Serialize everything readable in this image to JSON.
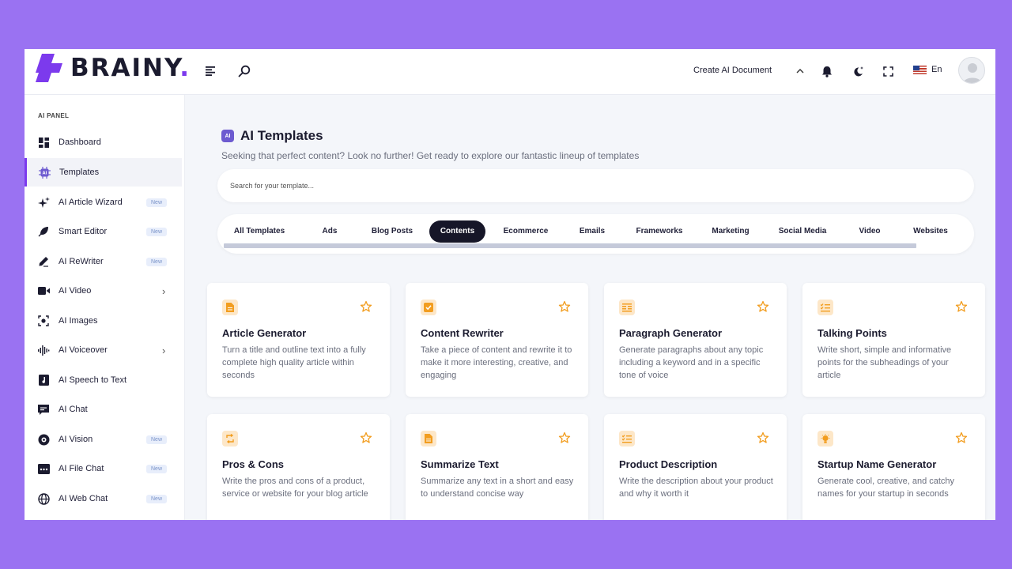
{
  "app": {
    "brand": "BRAINY",
    "brand_dot": ".",
    "accent": "#7c3aed",
    "background": "#9a72f2"
  },
  "header": {
    "menu_icon": "menu-icon",
    "search_icon": "search-icon",
    "create_doc_label": "Create AI Document",
    "lang_label": "En"
  },
  "sidebar": {
    "panel_label": "AI PANEL",
    "items": [
      {
        "label": "Dashboard",
        "icon": "dashboard-icon"
      },
      {
        "label": "Templates",
        "icon": "ai-chip-icon"
      },
      {
        "label": "AI Article Wizard",
        "icon": "sparkles-icon",
        "badge": "New"
      },
      {
        "label": "Smart Editor",
        "icon": "feather-icon",
        "badge": "New"
      },
      {
        "label": "AI ReWriter",
        "icon": "pen-icon",
        "badge": "New"
      },
      {
        "label": "AI Video",
        "icon": "video-icon"
      },
      {
        "label": "AI Images",
        "icon": "image-icon"
      },
      {
        "label": "AI Voiceover",
        "icon": "waveform-icon"
      },
      {
        "label": "AI Speech to Text",
        "icon": "music-file-icon"
      },
      {
        "label": "AI Chat",
        "icon": "chat-icon"
      },
      {
        "label": "AI Vision",
        "icon": "vision-icon",
        "badge": "New"
      },
      {
        "label": "AI File Chat",
        "icon": "file-chat-icon",
        "badge": "New"
      },
      {
        "label": "AI Web Chat",
        "icon": "globe-icon",
        "badge": "New"
      }
    ]
  },
  "main": {
    "ai_chip": "AI",
    "title": "AI Templates",
    "subtitle": "Seeking that perfect content? Look no further! Get ready to explore our fantastic lineup of templates",
    "search_placeholder": "Search for your template...",
    "tabs": [
      "All Templates",
      "Ads",
      "Blog Posts",
      "Contents",
      "Ecommerce",
      "Emails",
      "Frameworks",
      "Marketing",
      "Social Media",
      "Video",
      "Websites"
    ],
    "active_tab": "Contents",
    "cards": [
      {
        "title": "Article Generator",
        "desc": "Turn a title and outline text into a fully complete high quality article within seconds",
        "icon": "document-icon"
      },
      {
        "title": "Content Rewriter",
        "desc": "Take a piece of content and rewrite it to make it more interesting, creative, and engaging",
        "icon": "checkbox-icon"
      },
      {
        "title": "Paragraph Generator",
        "desc": "Generate paragraphs about any topic including a keyword and in a specific tone of voice",
        "icon": "align-icon"
      },
      {
        "title": "Talking Points",
        "desc": "Write short, simple and informative points for the subheadings of your article",
        "icon": "checklist-icon"
      },
      {
        "title": "Pros & Cons",
        "desc": "Write the pros and cons of a product, service or website for your blog article",
        "icon": "swap-icon"
      },
      {
        "title": "Summarize Text",
        "desc": "Summarize any text in a short and easy to understand concise way",
        "icon": "document-icon"
      },
      {
        "title": "Product Description",
        "desc": "Write the description about your product and why it worth it",
        "icon": "checklist-icon"
      },
      {
        "title": "Startup Name Generator",
        "desc": "Generate cool, creative, and catchy names for your startup in seconds",
        "icon": "bulb-icon"
      }
    ]
  }
}
